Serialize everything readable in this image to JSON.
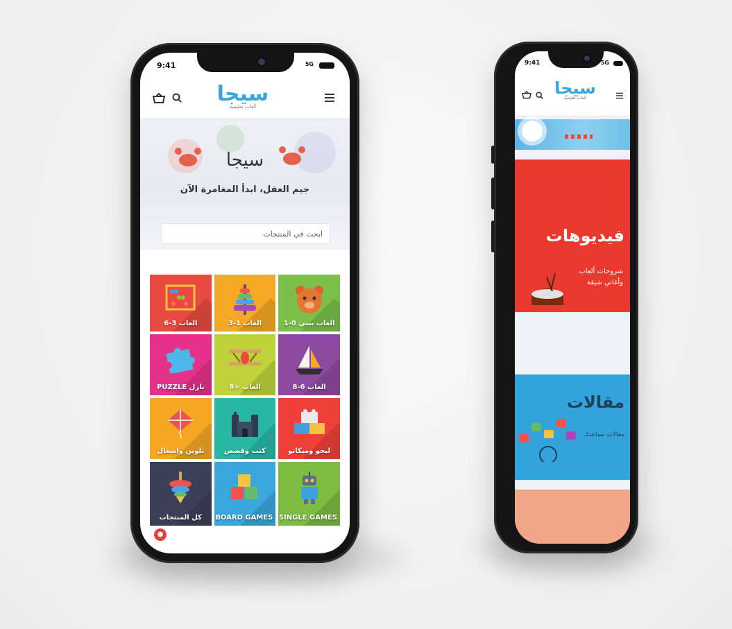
{
  "left_phone": {
    "status": {
      "time": "9:41",
      "network": "5G"
    },
    "header": {
      "logo_word": "سيجا",
      "logo_sub": "ألعاب تعليمية"
    },
    "hero": {
      "brand": "سيجا",
      "tagline": "جيم العقل، ابدأ المغامرة الآن"
    },
    "search": {
      "placeholder": "ابحث في المنتجات"
    },
    "tiles": [
      {
        "label": "العاب 3-6",
        "color": "#e94a3f",
        "icon": "abacus-icon"
      },
      {
        "label": "العاب 1-3",
        "color": "#f4a825",
        "icon": "ring-stacker-icon"
      },
      {
        "label": "العاب بيبي 0-1",
        "color": "#7cc04b",
        "icon": "teddy-bear-icon"
      },
      {
        "label": "بازل PUZZLE",
        "color": "#e6318a",
        "icon": "puzzle-piece-icon"
      },
      {
        "label": "العاب +8",
        "color": "#bfd23a",
        "icon": "airplane-icon"
      },
      {
        "label": "العاب 6-8",
        "color": "#8e4a9e",
        "icon": "sailboat-icon"
      },
      {
        "label": "تلوين واشغال",
        "color": "#f5a623",
        "icon": "kite-icon"
      },
      {
        "label": "كتب وقصص",
        "color": "#28b7a3",
        "icon": "castle-icon"
      },
      {
        "label": "ليجو وميكانو",
        "color": "#ee4038",
        "icon": "lego-blocks-icon"
      },
      {
        "label": "كل المنتجات",
        "color": "#3c3f58",
        "icon": "spinning-top-icon"
      },
      {
        "label": "BOARD GAMES",
        "color": "#3aa8dc",
        "icon": "cubes-icon"
      },
      {
        "label": "SINGLE GAMES",
        "color": "#7dbb42",
        "icon": "robot-icon"
      }
    ]
  },
  "right_phone": {
    "status": {
      "time": "9:41",
      "network": "5G"
    },
    "header": {
      "logo_word": "سيجا",
      "logo_sub": "ألعاب تعليمية"
    },
    "videos": {
      "title": "فيديوهات",
      "subtitle_1": "شروحات ألعاب",
      "subtitle_2": "وأغاني شيقة",
      "color": "#e9392f"
    },
    "articles": {
      "title": "مقالات",
      "subtitle": "مقالات تساعدك",
      "color": "#33a3dc"
    },
    "footer_color": "#f2a688"
  }
}
